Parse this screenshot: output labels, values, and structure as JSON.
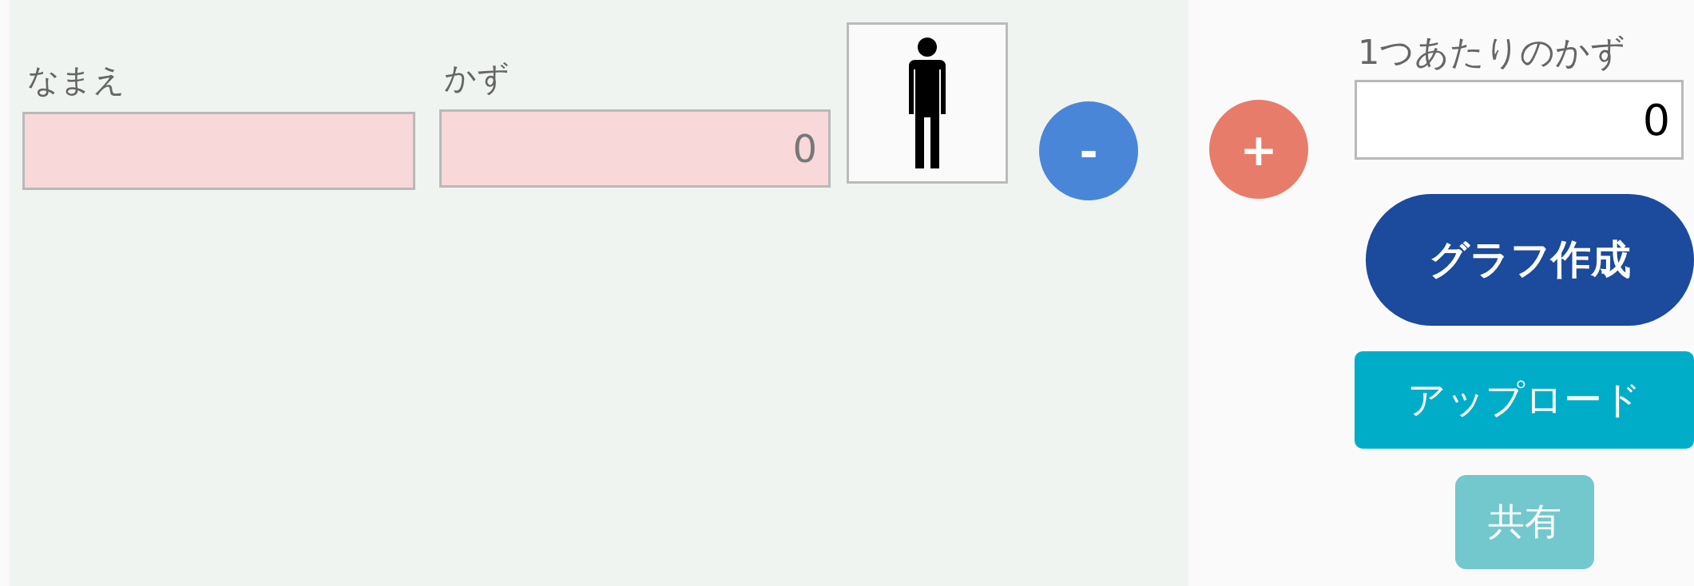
{
  "entry": {
    "name_label": "なまえ",
    "count_label": "かず",
    "count_field": {
      "value": "0"
    }
  },
  "stepper": {
    "minus": "-",
    "plus": "+"
  },
  "per_unit": {
    "label": "1つあたりのかず",
    "field": {
      "value": "0"
    }
  },
  "actions": [
    {
      "kind": "primary",
      "label": "グラフ作成",
      "disabled": false
    },
    {
      "kind": "upload",
      "label": "アップロード",
      "disabled": false
    },
    {
      "kind": "share",
      "label": "共有",
      "disabled": true
    }
  ]
}
